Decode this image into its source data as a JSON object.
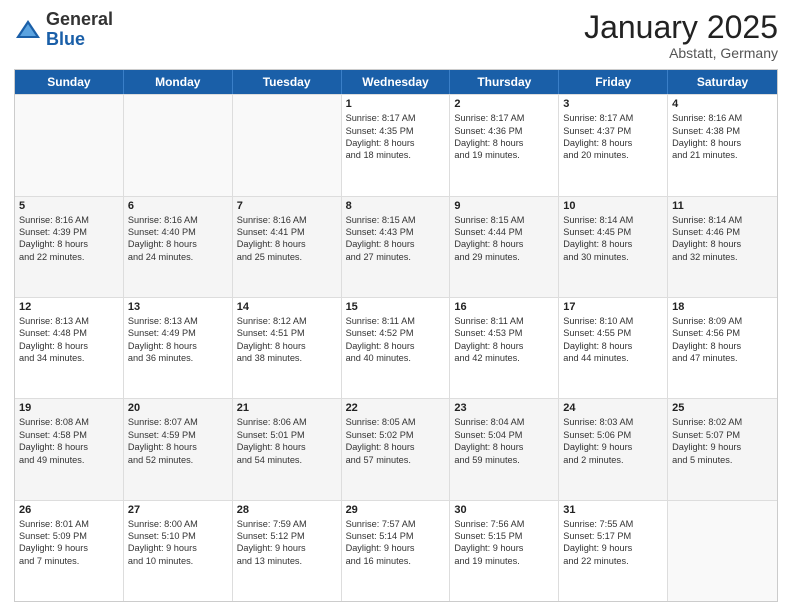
{
  "header": {
    "logo_general": "General",
    "logo_blue": "Blue",
    "month_title": "January 2025",
    "location": "Abstatt, Germany"
  },
  "weekdays": [
    "Sunday",
    "Monday",
    "Tuesday",
    "Wednesday",
    "Thursday",
    "Friday",
    "Saturday"
  ],
  "rows": [
    [
      {
        "day": "",
        "lines": [],
        "empty": true
      },
      {
        "day": "",
        "lines": [],
        "empty": true
      },
      {
        "day": "",
        "lines": [],
        "empty": true
      },
      {
        "day": "1",
        "lines": [
          "Sunrise: 8:17 AM",
          "Sunset: 4:35 PM",
          "Daylight: 8 hours",
          "and 18 minutes."
        ]
      },
      {
        "day": "2",
        "lines": [
          "Sunrise: 8:17 AM",
          "Sunset: 4:36 PM",
          "Daylight: 8 hours",
          "and 19 minutes."
        ]
      },
      {
        "day": "3",
        "lines": [
          "Sunrise: 8:17 AM",
          "Sunset: 4:37 PM",
          "Daylight: 8 hours",
          "and 20 minutes."
        ]
      },
      {
        "day": "4",
        "lines": [
          "Sunrise: 8:16 AM",
          "Sunset: 4:38 PM",
          "Daylight: 8 hours",
          "and 21 minutes."
        ]
      }
    ],
    [
      {
        "day": "5",
        "lines": [
          "Sunrise: 8:16 AM",
          "Sunset: 4:39 PM",
          "Daylight: 8 hours",
          "and 22 minutes."
        ],
        "shaded": true
      },
      {
        "day": "6",
        "lines": [
          "Sunrise: 8:16 AM",
          "Sunset: 4:40 PM",
          "Daylight: 8 hours",
          "and 24 minutes."
        ],
        "shaded": true
      },
      {
        "day": "7",
        "lines": [
          "Sunrise: 8:16 AM",
          "Sunset: 4:41 PM",
          "Daylight: 8 hours",
          "and 25 minutes."
        ],
        "shaded": true
      },
      {
        "day": "8",
        "lines": [
          "Sunrise: 8:15 AM",
          "Sunset: 4:43 PM",
          "Daylight: 8 hours",
          "and 27 minutes."
        ],
        "shaded": true
      },
      {
        "day": "9",
        "lines": [
          "Sunrise: 8:15 AM",
          "Sunset: 4:44 PM",
          "Daylight: 8 hours",
          "and 29 minutes."
        ],
        "shaded": true
      },
      {
        "day": "10",
        "lines": [
          "Sunrise: 8:14 AM",
          "Sunset: 4:45 PM",
          "Daylight: 8 hours",
          "and 30 minutes."
        ],
        "shaded": true
      },
      {
        "day": "11",
        "lines": [
          "Sunrise: 8:14 AM",
          "Sunset: 4:46 PM",
          "Daylight: 8 hours",
          "and 32 minutes."
        ],
        "shaded": true
      }
    ],
    [
      {
        "day": "12",
        "lines": [
          "Sunrise: 8:13 AM",
          "Sunset: 4:48 PM",
          "Daylight: 8 hours",
          "and 34 minutes."
        ]
      },
      {
        "day": "13",
        "lines": [
          "Sunrise: 8:13 AM",
          "Sunset: 4:49 PM",
          "Daylight: 8 hours",
          "and 36 minutes."
        ]
      },
      {
        "day": "14",
        "lines": [
          "Sunrise: 8:12 AM",
          "Sunset: 4:51 PM",
          "Daylight: 8 hours",
          "and 38 minutes."
        ]
      },
      {
        "day": "15",
        "lines": [
          "Sunrise: 8:11 AM",
          "Sunset: 4:52 PM",
          "Daylight: 8 hours",
          "and 40 minutes."
        ]
      },
      {
        "day": "16",
        "lines": [
          "Sunrise: 8:11 AM",
          "Sunset: 4:53 PM",
          "Daylight: 8 hours",
          "and 42 minutes."
        ]
      },
      {
        "day": "17",
        "lines": [
          "Sunrise: 8:10 AM",
          "Sunset: 4:55 PM",
          "Daylight: 8 hours",
          "and 44 minutes."
        ]
      },
      {
        "day": "18",
        "lines": [
          "Sunrise: 8:09 AM",
          "Sunset: 4:56 PM",
          "Daylight: 8 hours",
          "and 47 minutes."
        ]
      }
    ],
    [
      {
        "day": "19",
        "lines": [
          "Sunrise: 8:08 AM",
          "Sunset: 4:58 PM",
          "Daylight: 8 hours",
          "and 49 minutes."
        ],
        "shaded": true
      },
      {
        "day": "20",
        "lines": [
          "Sunrise: 8:07 AM",
          "Sunset: 4:59 PM",
          "Daylight: 8 hours",
          "and 52 minutes."
        ],
        "shaded": true
      },
      {
        "day": "21",
        "lines": [
          "Sunrise: 8:06 AM",
          "Sunset: 5:01 PM",
          "Daylight: 8 hours",
          "and 54 minutes."
        ],
        "shaded": true
      },
      {
        "day": "22",
        "lines": [
          "Sunrise: 8:05 AM",
          "Sunset: 5:02 PM",
          "Daylight: 8 hours",
          "and 57 minutes."
        ],
        "shaded": true
      },
      {
        "day": "23",
        "lines": [
          "Sunrise: 8:04 AM",
          "Sunset: 5:04 PM",
          "Daylight: 8 hours",
          "and 59 minutes."
        ],
        "shaded": true
      },
      {
        "day": "24",
        "lines": [
          "Sunrise: 8:03 AM",
          "Sunset: 5:06 PM",
          "Daylight: 9 hours",
          "and 2 minutes."
        ],
        "shaded": true
      },
      {
        "day": "25",
        "lines": [
          "Sunrise: 8:02 AM",
          "Sunset: 5:07 PM",
          "Daylight: 9 hours",
          "and 5 minutes."
        ],
        "shaded": true
      }
    ],
    [
      {
        "day": "26",
        "lines": [
          "Sunrise: 8:01 AM",
          "Sunset: 5:09 PM",
          "Daylight: 9 hours",
          "and 7 minutes."
        ]
      },
      {
        "day": "27",
        "lines": [
          "Sunrise: 8:00 AM",
          "Sunset: 5:10 PM",
          "Daylight: 9 hours",
          "and 10 minutes."
        ]
      },
      {
        "day": "28",
        "lines": [
          "Sunrise: 7:59 AM",
          "Sunset: 5:12 PM",
          "Daylight: 9 hours",
          "and 13 minutes."
        ]
      },
      {
        "day": "29",
        "lines": [
          "Sunrise: 7:57 AM",
          "Sunset: 5:14 PM",
          "Daylight: 9 hours",
          "and 16 minutes."
        ]
      },
      {
        "day": "30",
        "lines": [
          "Sunrise: 7:56 AM",
          "Sunset: 5:15 PM",
          "Daylight: 9 hours",
          "and 19 minutes."
        ]
      },
      {
        "day": "31",
        "lines": [
          "Sunrise: 7:55 AM",
          "Sunset: 5:17 PM",
          "Daylight: 9 hours",
          "and 22 minutes."
        ]
      },
      {
        "day": "",
        "lines": [],
        "empty": true
      }
    ]
  ]
}
